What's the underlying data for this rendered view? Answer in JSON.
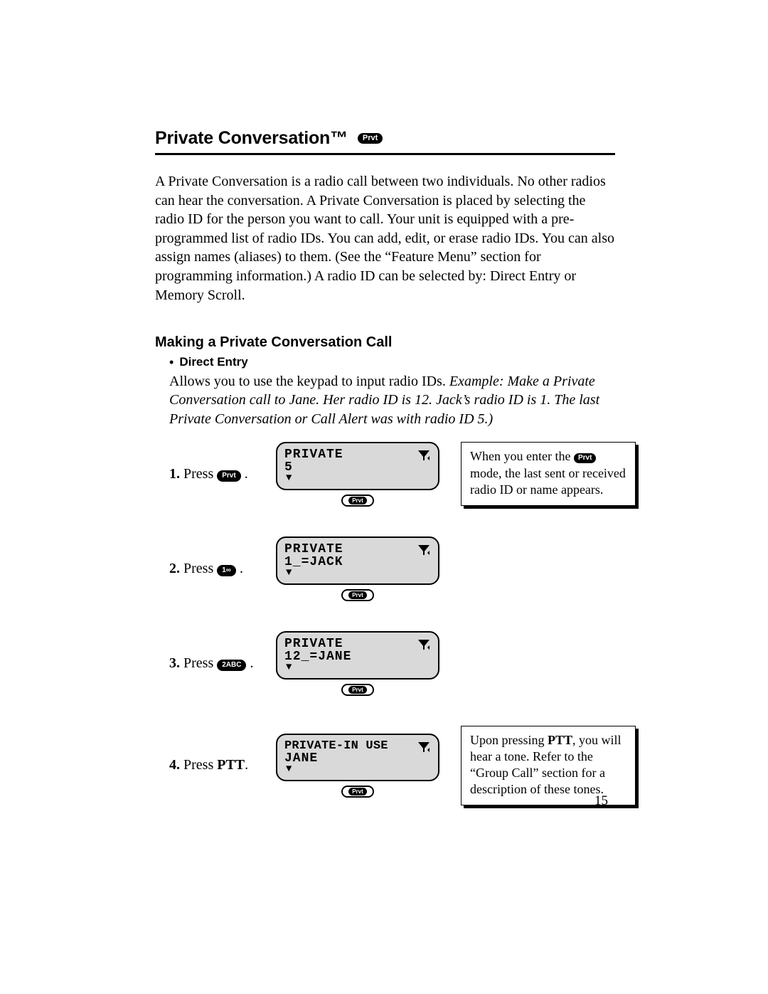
{
  "header": {
    "title": "Private Conversation™",
    "badge": "Prvt"
  },
  "intro": "A Private Conversation is a radio call between two individuals. No other radios can hear the conversation. A Private Conversation is placed by selecting the radio ID for the person you want to call. Your unit is equipped with a pre-programmed list of radio IDs. You can add, edit, or erase radio IDs. You can also assign names (aliases) to them. (See the “Feature Menu” section for programming information.) A radio ID can be selected by: Direct Entry or Memory Scroll.",
  "subheading": "Making a Private Conversation Call",
  "bullet": {
    "label": "Direct Entry",
    "body_plain": "Allows you to use the keypad to input radio IDs. ",
    "body_italic": "Example: Make a Private Conversation call to Jane. Her radio ID is 12. Jack’s radio ID is 1. The last Private Conversation or Call Alert was with radio ID 5.)"
  },
  "steps": [
    {
      "num": "1.",
      "verb": "Press",
      "key": "Prvt",
      "lcd": {
        "line1": "PRIVATE",
        "line2": "5",
        "soft": "Prvt"
      },
      "note_pre": "When you enter the ",
      "note_badge": "Prvt",
      "note_post": " mode, the last sent or received radio ID or name appears."
    },
    {
      "num": "2.",
      "verb": "Press",
      "key": "1∞",
      "lcd": {
        "line1": "PRIVATE",
        "line2": "1_=JACK",
        "soft": "Prvt"
      }
    },
    {
      "num": "3.",
      "verb": "Press",
      "key": "2ABC",
      "lcd": {
        "line1": "PRIVATE",
        "line2": "12_=JANE",
        "soft": "Prvt"
      }
    },
    {
      "num": "4.",
      "verb": "Press ",
      "key_bold": "PTT",
      "lcd": {
        "line1": "PRIVATE-IN USE",
        "line2": "JANE",
        "soft": "Prvt"
      },
      "note_pre": "Upon pressing ",
      "note_bold": "PTT",
      "note_post": ", you will hear a tone. Refer to the “Group Call” section for a description of these tones."
    }
  ],
  "page_number": "15"
}
